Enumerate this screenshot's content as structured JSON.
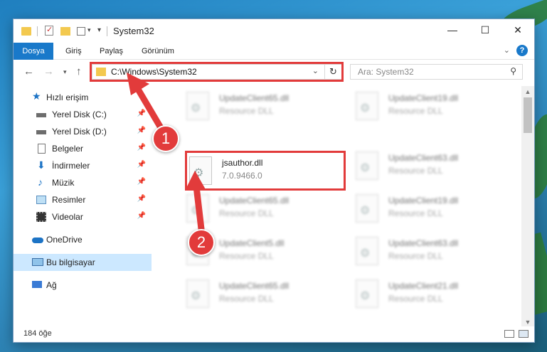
{
  "window": {
    "title": "System32",
    "minimize": "—",
    "maximize": "☐",
    "close": "✕"
  },
  "ribbon": {
    "file_tab": "Dosya",
    "tabs": [
      "Giriş",
      "Paylaş",
      "Görünüm"
    ],
    "help": "?"
  },
  "address": {
    "path": "C:\\Windows\\System32",
    "search_placeholder": "Ara: System32"
  },
  "sidebar": {
    "items": [
      {
        "label": "Hızlı erişim",
        "icon": "star-icon"
      },
      {
        "label": "Yerel Disk (C:)",
        "icon": "drive-icon",
        "pinned": true
      },
      {
        "label": "Yerel Disk (D:)",
        "icon": "drive-icon",
        "pinned": true
      },
      {
        "label": "Belgeler",
        "icon": "documents-icon",
        "pinned": true
      },
      {
        "label": "İndirmeler",
        "icon": "downloads-icon",
        "pinned": true
      },
      {
        "label": "Müzik",
        "icon": "music-icon",
        "pinned": true
      },
      {
        "label": "Resimler",
        "icon": "pictures-icon",
        "pinned": true
      },
      {
        "label": "Videolar",
        "icon": "videos-icon",
        "pinned": true
      },
      {
        "label": "OneDrive",
        "icon": "onedrive-icon"
      },
      {
        "label": "Bu bilgisayar",
        "icon": "computer-icon",
        "selected": true
      },
      {
        "label": "Ağ",
        "icon": "network-icon"
      }
    ]
  },
  "files": {
    "highlighted": {
      "name": "jsauthor.dll",
      "desc": "7.0.9466.0"
    },
    "left_column": [
      {
        "name": "UpdateClient65.dll",
        "desc": "Resource DLL"
      },
      {
        "name": "UpdateClient65.dll",
        "desc": "Resource DLL"
      },
      {
        "name": "UpdateClient5.dll",
        "desc": "Resource DLL"
      },
      {
        "name": "UpdateClient65.dll",
        "desc": "Resource DLL"
      }
    ],
    "right_column": [
      {
        "name": "UpdateClient19.dll",
        "desc": "Resource DLL"
      },
      {
        "name": "UpdateClient63.dll",
        "desc": "Resource DLL"
      },
      {
        "name": "UpdateClient19.dll",
        "desc": "Resource DLL"
      },
      {
        "name": "UpdateClient63.dll",
        "desc": "Resource DLL"
      },
      {
        "name": "UpdateClient21.dll",
        "desc": "Resource DLL"
      }
    ]
  },
  "status": {
    "count": "184 öğe"
  },
  "annotations": {
    "step1": "1",
    "step2": "2"
  },
  "colors": {
    "accent": "#1979ca",
    "highlight": "#e23b3b",
    "selected": "#cce8ff"
  }
}
